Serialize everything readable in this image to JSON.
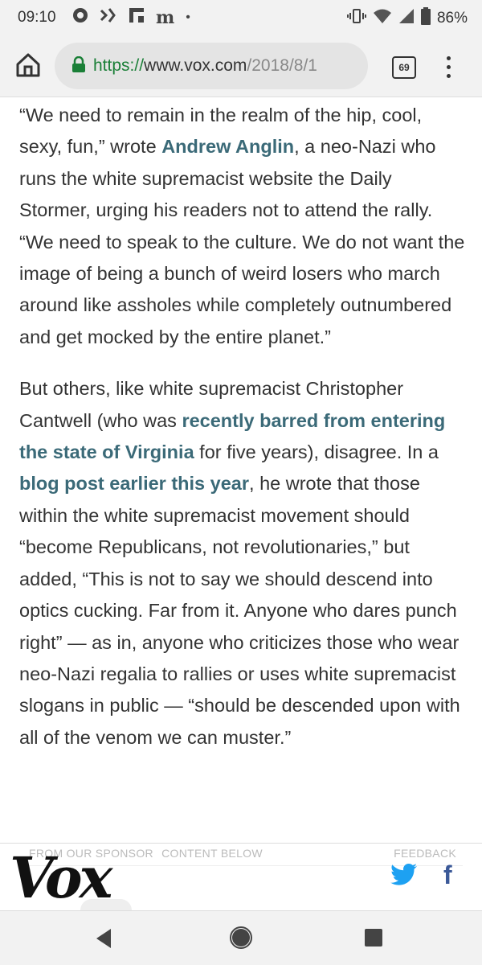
{
  "status_bar": {
    "time": "09:10",
    "notification_icons": [
      "settings-cog-icon",
      "app-icon",
      "flipboard-icon",
      "medium-icon"
    ],
    "dot": "•",
    "battery": "86%"
  },
  "browser": {
    "url_scheme": "https://",
    "url_host": "www.vox.com",
    "url_path": "/2018/8/1",
    "tab_count": "69",
    "secure_color": "#1a7f37"
  },
  "article": {
    "p1": [
      {
        "text": "“We need to remain in the realm of the hip, cool, sexy, fun,” wrote "
      },
      {
        "text": "Andrew Anglin",
        "link": true
      },
      {
        "text": ", a neo-Nazi who runs the white supremacist website the Daily Stormer, urging his readers not to attend the rally. “We need to speak to the culture. We do not want the image of being a bunch of weird losers who march around like assholes while completely outnumbered and get mocked by the entire planet.”"
      }
    ],
    "p2": [
      {
        "text": "But others, like white supremacist Christopher Cantwell (who was "
      },
      {
        "text": "recently barred from entering the state of Virginia",
        "link": true
      },
      {
        "text": " for five years), disagree. In a "
      },
      {
        "text": "blog post earlier this year",
        "link": true
      },
      {
        "text": ", he wrote that those within the white supremacist movement should “become Republicans, not revolutionaries,” but added, “This is not to say we should descend into optics cucking. Far from it. Anyone who dares punch right” — as in, anyone who criticizes those who wear neo-Nazi regalia to rallies or uses white supremacist slogans in public — “should be descended upon with all of the venom we can muster.”"
      }
    ],
    "link_color": "#3b6a78"
  },
  "sponsor": {
    "label": "FROM OUR SPONSOR",
    "content_below": "CONTENT BELOW",
    "feedback": "FEEDBACK"
  },
  "footer": {
    "logo": "Vox",
    "twitter_color": "#1da1f2",
    "facebook_glyph": "f"
  }
}
